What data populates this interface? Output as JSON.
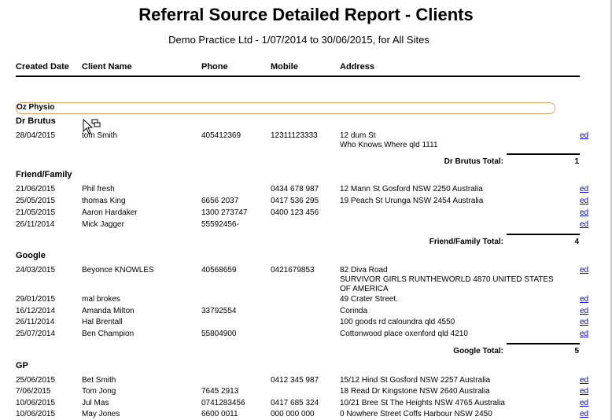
{
  "report": {
    "title": "Referral Source Detailed Report - Clients",
    "subtitle": "Demo Practice Ltd - 1/07/2014 to 30/06/2015, for All Sites"
  },
  "columns": {
    "created_date": "Created Date",
    "client_name": "Client Name",
    "phone": "Phone",
    "mobile": "Mobile",
    "address": "Address"
  },
  "site": "Oz Physio",
  "groups": [
    {
      "name": "Dr Brutus",
      "rows": [
        {
          "date": "28/04/2015",
          "name": "tom Smith",
          "phone": "405412369",
          "mobile": "12311123333",
          "address": "12 dum St",
          "address2": " Who Knows Where qld  1111",
          "edit": "ed"
        }
      ],
      "total_label": "Dr Brutus Total:",
      "total": "1"
    },
    {
      "name": "Friend/Family",
      "rows": [
        {
          "date": "21/06/2015",
          "name": "Phil fresh",
          "phone": "",
          "mobile": "0434 678 987",
          "address": "12 Mann St Gosford NSW  2250 Australia",
          "edit": "ed"
        },
        {
          "date": "25/05/2015",
          "name": "thomas King",
          "phone": "6656 2037",
          "mobile": "0417 536 295",
          "address": "19 Peach St Urunga NSW  2454 Australia",
          "edit": "ed"
        },
        {
          "date": "21/05/2015",
          "name": "Aaron Hardaker",
          "phone": "1300 273747",
          "mobile": "0400 123 456",
          "address": "",
          "edit": "ed"
        },
        {
          "date": "26/11/2014",
          "name": "Mick Jagger",
          "phone": "55592456-",
          "mobile": "",
          "address": "",
          "edit": "ed"
        }
      ],
      "total_label": "Friend/Family Total:",
      "total": "4"
    },
    {
      "name": "Google",
      "rows": [
        {
          "date": "24/03/2015",
          "name": "Beyonce KNOWLES",
          "phone": "40568659",
          "mobile": "0421679853",
          "address": "82 Diva Road",
          "address2": " SURVIVOR GIRLS RUNTHEWORLD  4870 UNITED STATES",
          "address3": "OF AMERICA",
          "edit": "ed"
        },
        {
          "date": "29/01/2015",
          "name": "mal brokes",
          "phone": "",
          "mobile": "",
          "address": "49 Crater Street.",
          "edit": "ed"
        },
        {
          "date": "16/12/2014",
          "name": "Amanda Milton",
          "phone": "33792554",
          "mobile": "",
          "address": " Corinda",
          "edit": "ed"
        },
        {
          "date": "26/11/2014",
          "name": "Hal Brentall",
          "phone": "",
          "mobile": "",
          "address": "100 goods rd caloundra qld  4550",
          "edit": "ed"
        },
        {
          "date": "25/07/2014",
          "name": "Ben Champion",
          "phone": "55804900",
          "mobile": "",
          "address": "Cottonwood place oxenford qld  4210",
          "edit": "ed"
        }
      ],
      "total_label": "Google Total:",
      "total": "5"
    },
    {
      "name": "GP",
      "rows": [
        {
          "date": "25/06/2015",
          "name": "Bet Smith",
          "phone": "",
          "mobile": "0412 345 987",
          "address": "15/12 Hind St Gosford NSW  2257 Australia",
          "edit": "ed"
        },
        {
          "date": "7/06/2015",
          "name": "Tom Jong",
          "phone": "7645 2913",
          "mobile": "",
          "address": "18 Read Dr Kingstone NSW  2640 Australia",
          "edit": "ed"
        },
        {
          "date": "10/06/2015",
          "name": "Jul Mas",
          "phone": "0741283456",
          "mobile": "0417 685 324",
          "address": "10/21 Bree St The Heights NSW  4765 Australia",
          "edit": "ed"
        },
        {
          "date": "10/06/2015",
          "name": "May Jones",
          "phone": "6600 0011",
          "mobile": "000 000 000",
          "address": "0 Nowhere Street Coffs Harbour NSW  2450",
          "edit": "ed"
        }
      ]
    }
  ]
}
